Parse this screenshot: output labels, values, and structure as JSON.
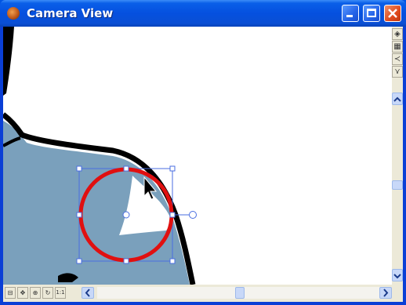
{
  "window": {
    "title": "Camera View",
    "icon": "camera-view-app-icon"
  },
  "titlebar_buttons": {
    "minimize": "minimize-icon",
    "maximize": "maximize-icon",
    "close": "close-icon"
  },
  "right_toolbar": {
    "tools": [
      "camera-icon",
      "render-icon",
      "flip-horizontal-icon",
      "flip-vertical-icon"
    ]
  },
  "bottom_toolbar": {
    "tools": [
      "reset-view-icon",
      "pan-icon",
      "zoom-icon",
      "rotate-icon",
      "actual-size-icon"
    ],
    "actual_size_label": "1:1"
  },
  "colors": {
    "titlebar": "#0550df",
    "fill_blue": "#7aa0bc",
    "outline": "#000000",
    "selection": "#e01010",
    "handles": "#4a6ee0"
  }
}
